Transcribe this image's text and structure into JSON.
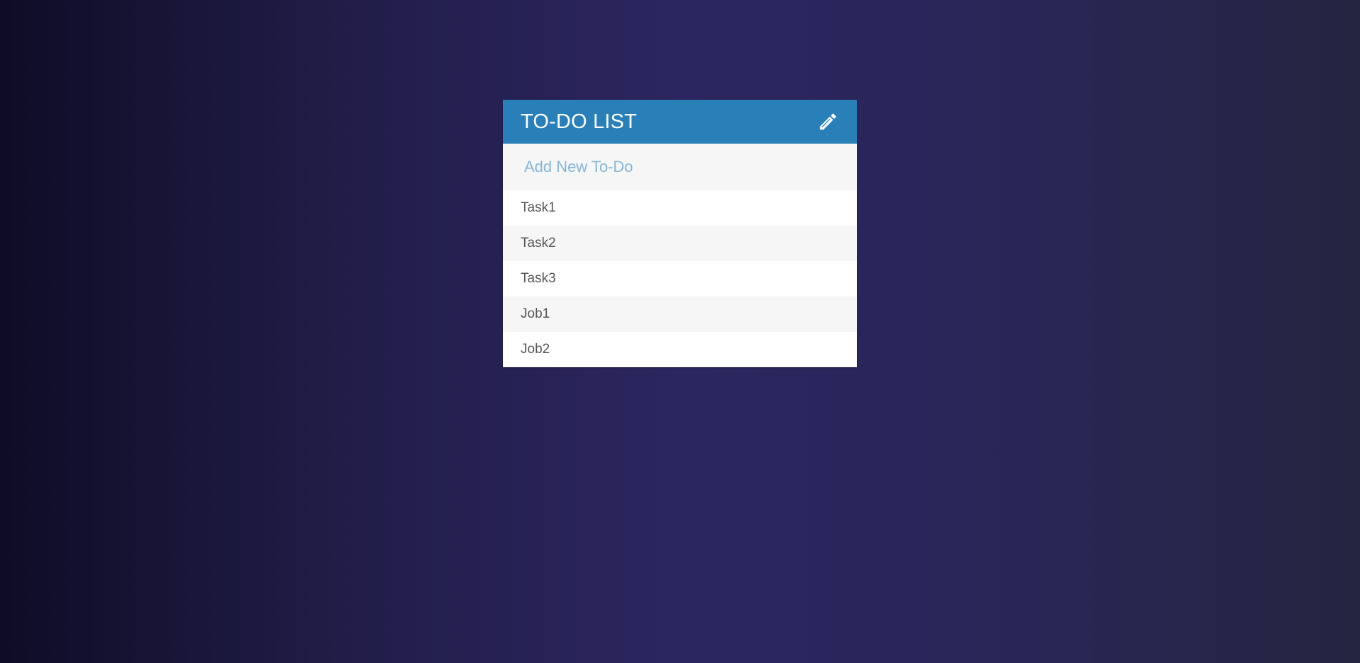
{
  "todo": {
    "title": "TO-DO LIST",
    "edit_icon": "pencil-icon",
    "add_placeholder": "Add New To-Do",
    "add_value": "",
    "items": [
      {
        "label": "Task1"
      },
      {
        "label": "Task2"
      },
      {
        "label": "Task3"
      },
      {
        "label": "Job1"
      },
      {
        "label": "Job2"
      }
    ]
  },
  "colors": {
    "header": "#2980b9",
    "placeholder": "#84b6d9",
    "item_text": "#555555",
    "row_alt": "#f6f6f6"
  }
}
